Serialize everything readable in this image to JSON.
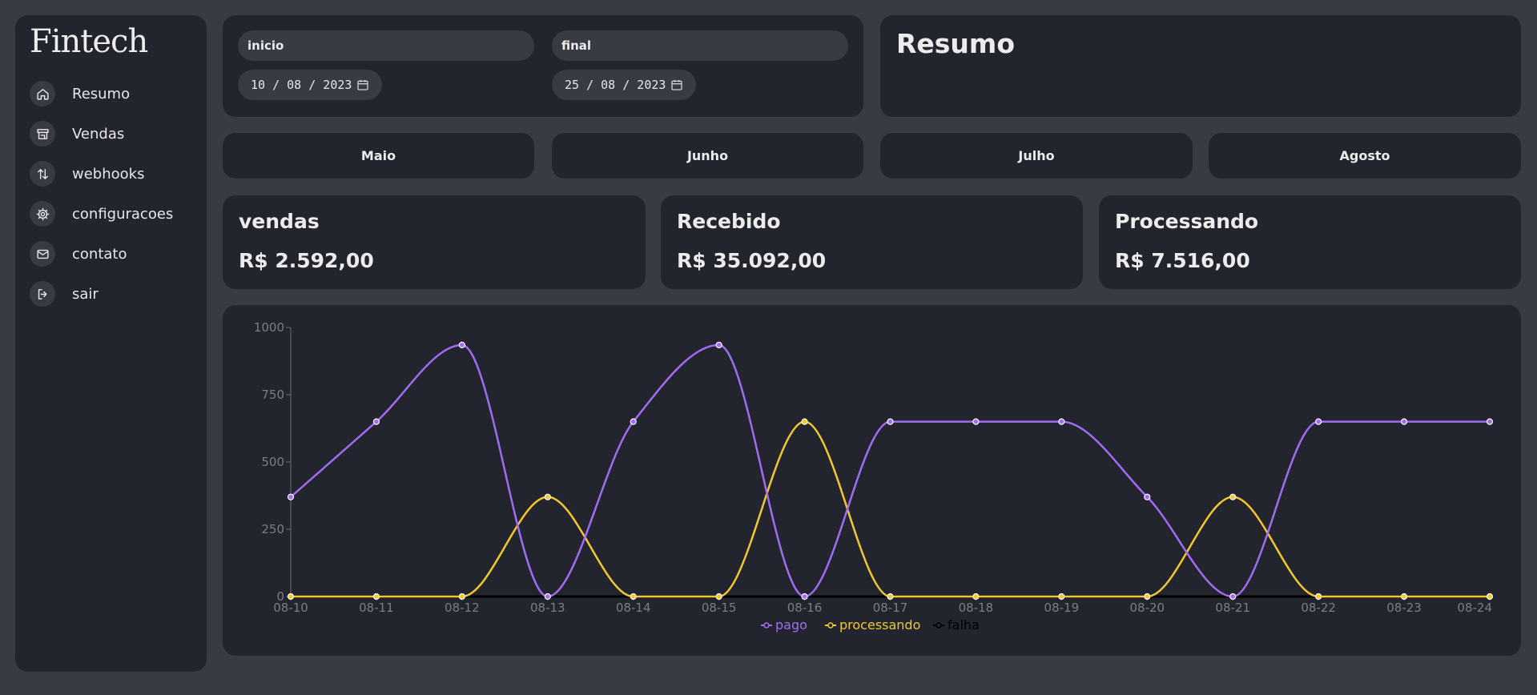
{
  "app": {
    "logo": "Fintech"
  },
  "sidebar": {
    "items": [
      {
        "label": "Resumo",
        "icon": "home-icon"
      },
      {
        "label": "Vendas",
        "icon": "store-icon"
      },
      {
        "label": "webhooks",
        "icon": "arrows-updown-icon"
      },
      {
        "label": "configuracoes",
        "icon": "gear-icon"
      },
      {
        "label": "contato",
        "icon": "mail-icon"
      },
      {
        "label": "sair",
        "icon": "logout-icon"
      }
    ]
  },
  "filter": {
    "start": {
      "label": "inicio",
      "value": "10 / 08 / 2023"
    },
    "end": {
      "label": "final",
      "value": "25 / 08 / 2023"
    }
  },
  "resumo": {
    "title": "Resumo"
  },
  "months": [
    "Maio",
    "Junho",
    "Julho",
    "Agosto"
  ],
  "cards": [
    {
      "title": "vendas",
      "value": "R$ 2.592,00"
    },
    {
      "title": "Recebido",
      "value": "R$ 35.092,00"
    },
    {
      "title": "Processando",
      "value": "R$ 7.516,00"
    }
  ],
  "chart_data": {
    "type": "line",
    "x": [
      "08-10",
      "08-11",
      "08-12",
      "08-13",
      "08-14",
      "08-15",
      "08-16",
      "08-17",
      "08-18",
      "08-19",
      "08-20",
      "08-21",
      "08-22",
      "08-23",
      "08-24"
    ],
    "ylim": [
      0,
      1000
    ],
    "yticks": [
      0,
      250,
      500,
      750,
      1000
    ],
    "grid": false,
    "legend": "bottom",
    "series": [
      {
        "name": "pago",
        "color": "#a06cf2",
        "values": [
          370,
          650,
          935,
          0,
          650,
          935,
          0,
          650,
          650,
          650,
          370,
          0,
          650,
          650,
          650
        ]
      },
      {
        "name": "processando",
        "color": "#f3c72f",
        "values": [
          0,
          0,
          0,
          370,
          0,
          0,
          650,
          0,
          0,
          0,
          0,
          370,
          0,
          0,
          0
        ]
      },
      {
        "name": "falha",
        "color": "#000000",
        "values": [
          0,
          0,
          0,
          0,
          0,
          0,
          0,
          0,
          0,
          0,
          0,
          0,
          0,
          0,
          0
        ]
      }
    ]
  }
}
